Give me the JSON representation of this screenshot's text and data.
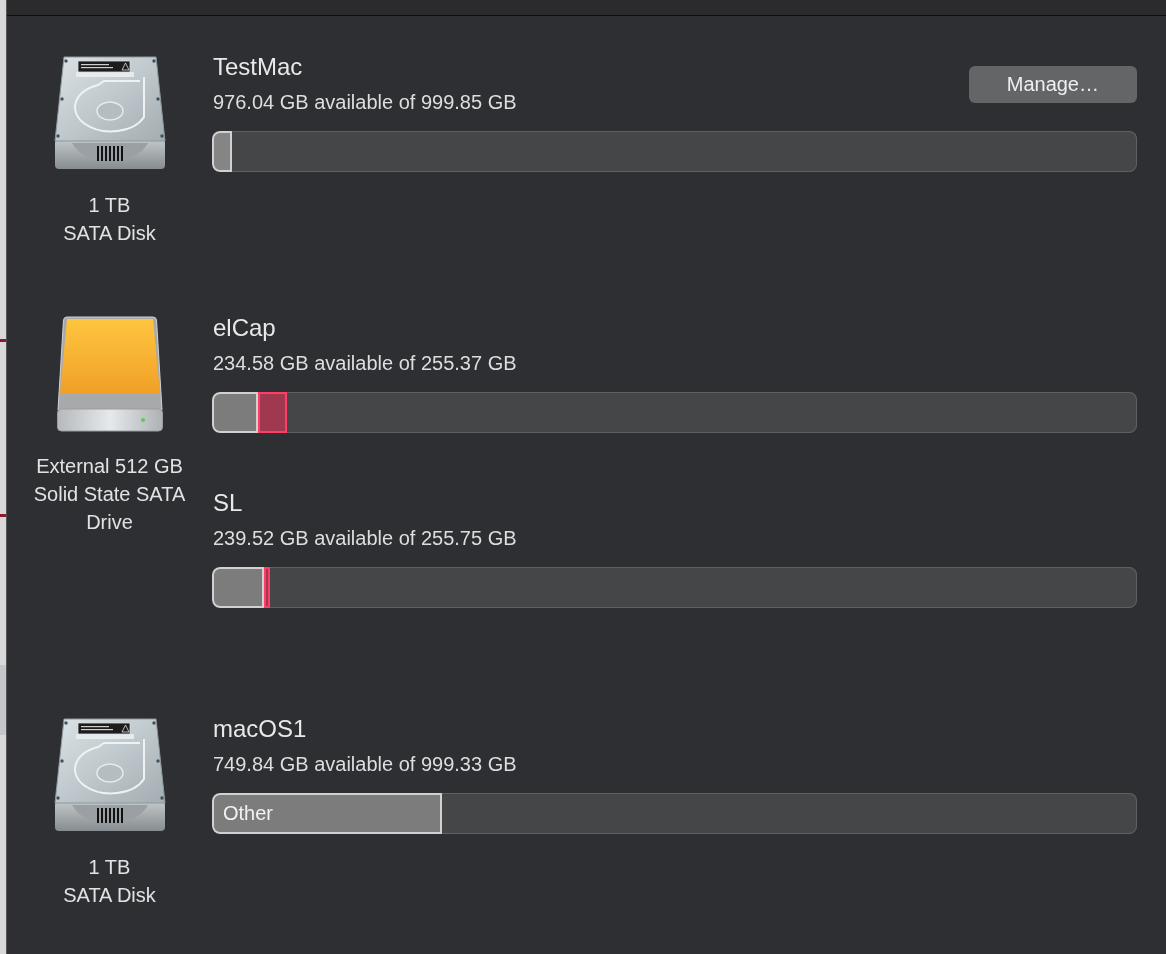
{
  "disks": [
    {
      "kind": "internal",
      "description": "1 TB\nSATA Disk",
      "volumes": [
        {
          "name": "TestMac",
          "capacity": "976.04 GB available of 999.85 GB",
          "button": "Manage…",
          "segments": [
            {
              "level": 0.022,
              "color": "#848584"
            }
          ]
        }
      ]
    },
    {
      "kind": "external",
      "description": "External 512 GB\nSolid State SATA\nDrive",
      "volumes": [
        {
          "name": "elCap",
          "capacity": "234.58 GB available of 255.37 GB",
          "segments": [
            {
              "level": 0.05,
              "color": "#7b7c7b"
            },
            {
              "level": 0.031,
              "color": "#a0384f"
            }
          ]
        },
        {
          "name": "SL",
          "capacity": "239.52 GB available of 255.75 GB",
          "segments": [
            {
              "level": 0.056,
              "color": "#7b7c7b"
            },
            {
              "level": 0.007,
              "color": "#a0384f"
            }
          ]
        }
      ]
    },
    {
      "kind": "internal",
      "description": "1 TB\nSATA Disk",
      "volumes": [
        {
          "name": "macOS1",
          "capacity": "749.84 GB available of 999.33 GB",
          "segments": [
            {
              "level": 0.249,
              "color": "#7b7c7b",
              "label": "Other"
            }
          ]
        }
      ]
    }
  ]
}
